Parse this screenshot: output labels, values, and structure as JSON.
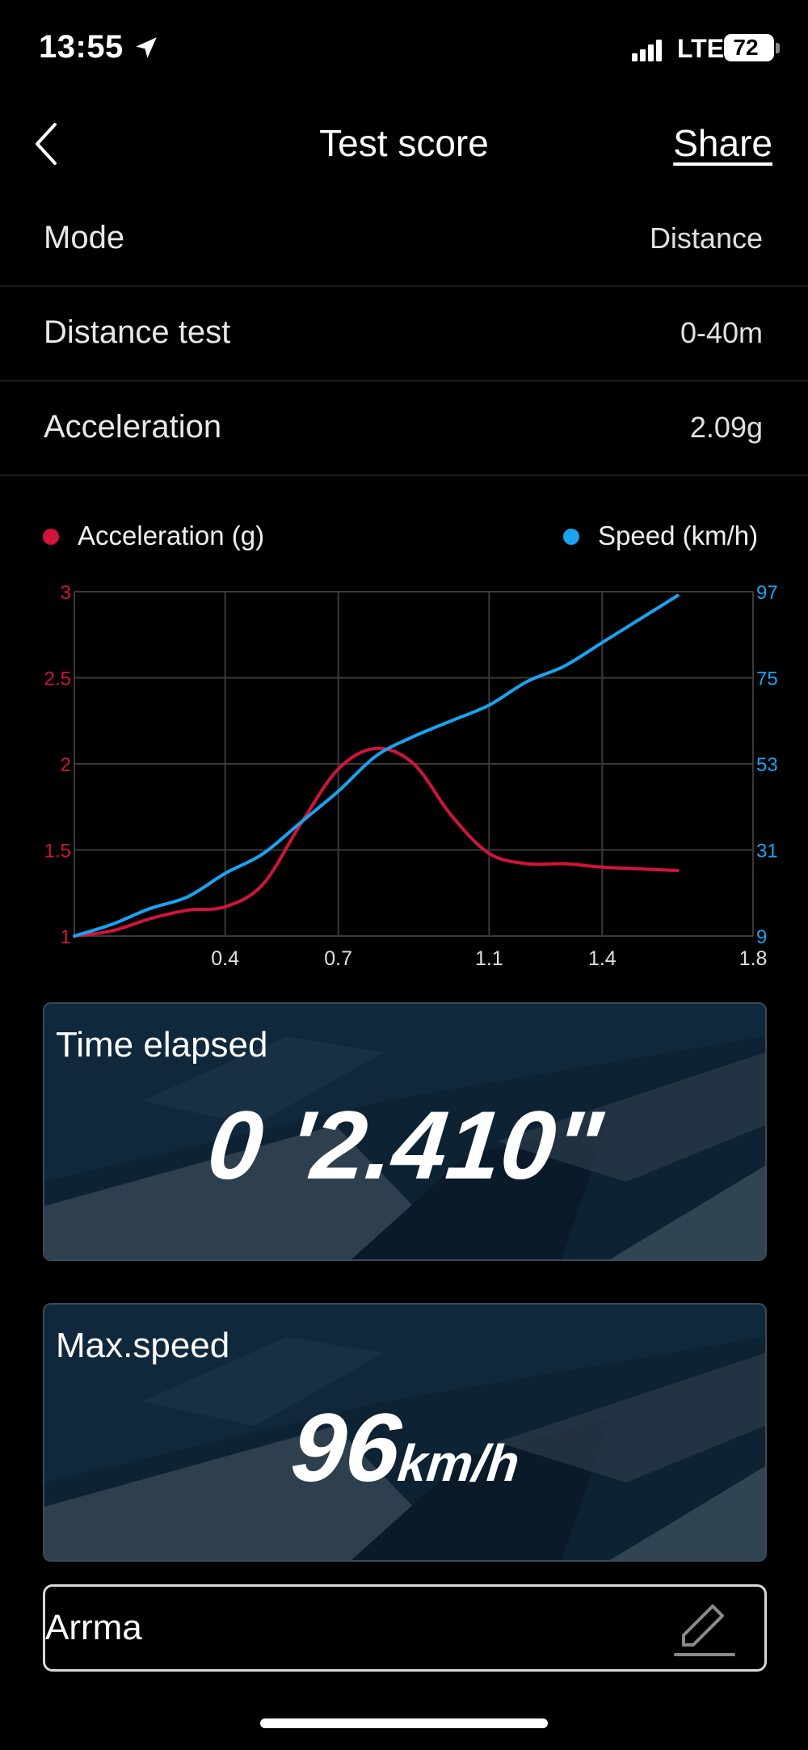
{
  "status_bar": {
    "time": "13:55",
    "network": "LTE",
    "battery": "72"
  },
  "nav": {
    "title": "Test score",
    "share_label": "Share"
  },
  "rows": [
    {
      "label": "Mode",
      "value": "Distance"
    },
    {
      "label": "Distance test",
      "value": "0-40m"
    },
    {
      "label": "Acceleration",
      "value": "2.09g"
    }
  ],
  "legend": {
    "acceleration": {
      "label": "Acceleration (g)",
      "color": "#d0143c"
    },
    "speed": {
      "label": "Speed (km/h)",
      "color": "#1aa3f0"
    }
  },
  "chart_data": {
    "type": "line",
    "x_ticks": [
      "0.4",
      "0.7",
      "1.1",
      "1.4",
      "1.8"
    ],
    "left_ticks": [
      "1",
      "1.5",
      "2",
      "2.5",
      "3"
    ],
    "right_ticks": [
      "9",
      "31",
      "53",
      "75",
      "97"
    ],
    "xlim": [
      0.0,
      1.8
    ],
    "ylim_left": [
      1,
      3
    ],
    "ylim_right": [
      9,
      97
    ],
    "grid": true,
    "legend_placement": "top",
    "series": [
      {
        "name": "Acceleration (g)",
        "axis": "left",
        "color": "#d0143c",
        "x": [
          0.0,
          0.1,
          0.2,
          0.3,
          0.4,
          0.5,
          0.6,
          0.7,
          0.8,
          0.9,
          1.0,
          1.1,
          1.2,
          1.3,
          1.4,
          1.5,
          1.6
        ],
        "y": [
          1.0,
          1.03,
          1.1,
          1.15,
          1.17,
          1.3,
          1.65,
          1.97,
          2.09,
          2.0,
          1.7,
          1.48,
          1.42,
          1.42,
          1.4,
          1.39,
          1.38
        ]
      },
      {
        "name": "Speed (km/h)",
        "axis": "right",
        "color": "#1aa3f0",
        "x": [
          0.0,
          0.1,
          0.2,
          0.3,
          0.4,
          0.5,
          0.6,
          0.7,
          0.8,
          0.9,
          1.0,
          1.1,
          1.2,
          1.3,
          1.4,
          1.5,
          1.6
        ],
        "y": [
          9,
          12,
          16,
          19,
          25,
          30,
          38,
          46,
          55,
          60,
          64,
          68,
          74,
          78,
          84,
          90,
          96
        ]
      }
    ]
  },
  "cards": {
    "time": {
      "label": "Time elapsed",
      "value": "0 '2.410\""
    },
    "speed": {
      "label": "Max.speed",
      "value": "96",
      "unit": "km/h"
    }
  },
  "name_field": {
    "value": "Arrma"
  }
}
